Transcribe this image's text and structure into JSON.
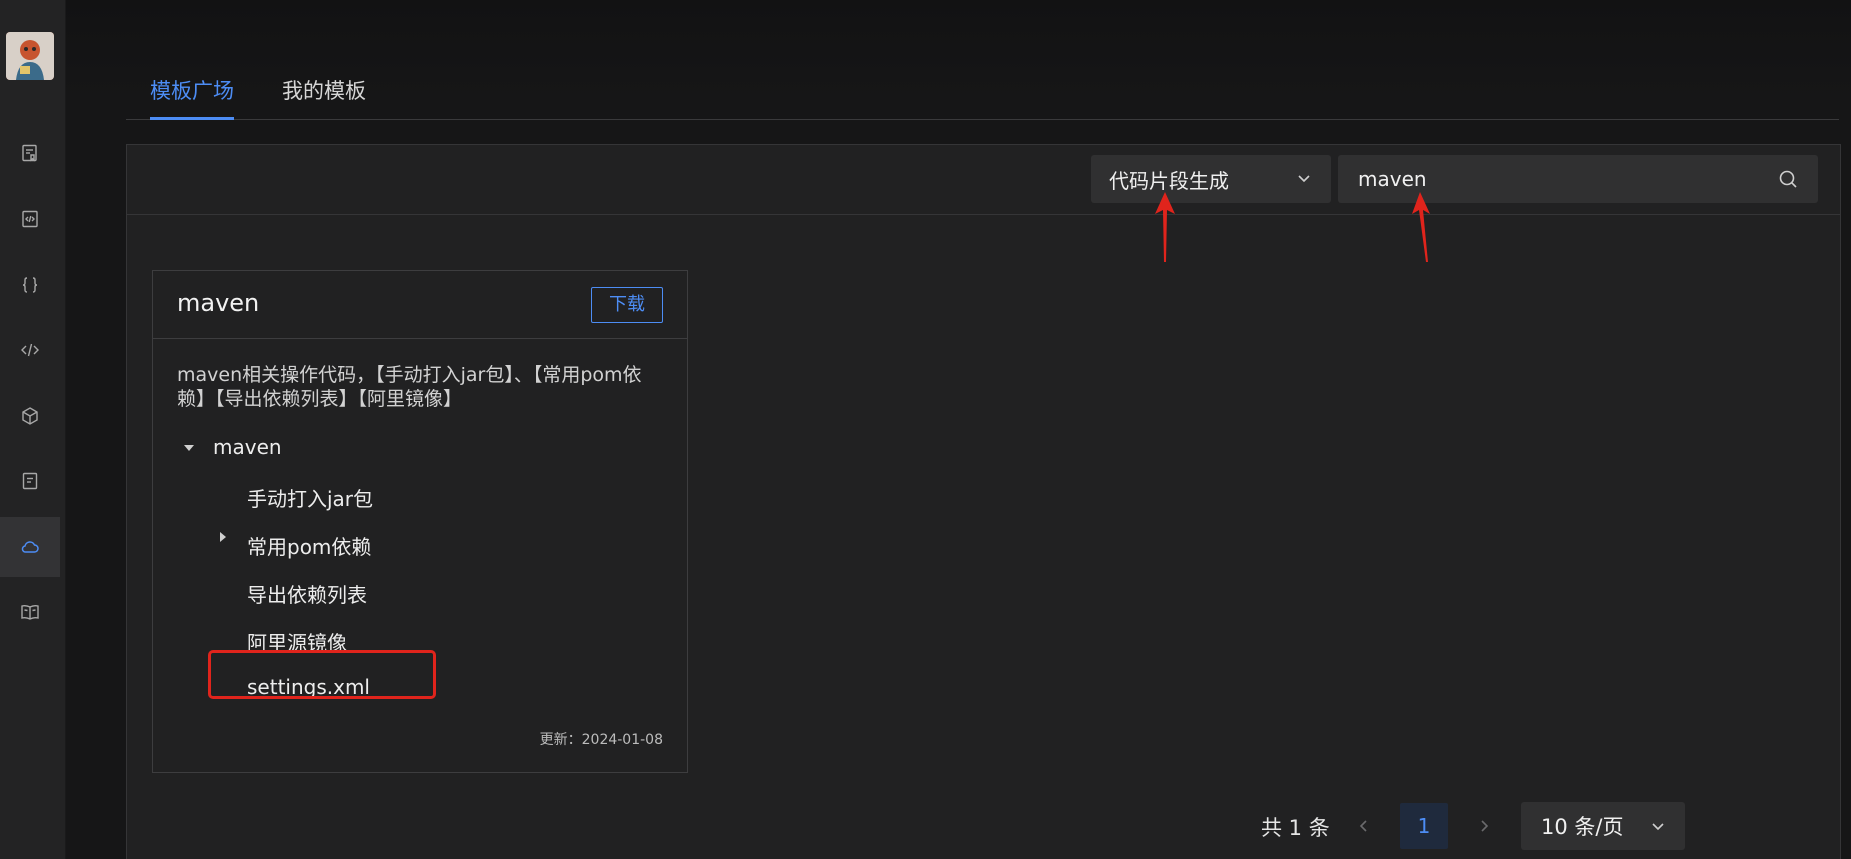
{
  "sidebar": {
    "items": [
      {
        "icon": "document-bookmark-icon"
      },
      {
        "icon": "code-file-icon"
      },
      {
        "icon": "braces-icon"
      },
      {
        "icon": "code-tag-icon"
      },
      {
        "icon": "cube-icon"
      },
      {
        "icon": "document-icon"
      },
      {
        "icon": "cloud-icon",
        "active": true
      },
      {
        "icon": "book-icon"
      }
    ]
  },
  "tabs": [
    {
      "label": "模板广场",
      "active": true
    },
    {
      "label": "我的模板",
      "active": false
    }
  ],
  "filter": {
    "category_value": "代码片段生成",
    "search_value": "maven"
  },
  "card": {
    "title": "maven",
    "download_label": "下载",
    "description": "maven相关操作代码，【手动打入jar包】、【常用pom依赖】【导出依赖列表】【阿里镜像】",
    "tree": {
      "root": "maven",
      "children": [
        "手动打入jar包",
        "常用pom依赖",
        "导出依赖列表",
        "阿里源镜像",
        "settings.xml"
      ]
    },
    "updated": "更新：2024-01-08"
  },
  "pagination": {
    "total_label": "共 1 条",
    "current_page": "1",
    "page_size_label": "10 条/页"
  },
  "colors": {
    "accent": "#4d8df5",
    "annotation": "#e0241c",
    "background": "#161617",
    "panel": "#212122"
  }
}
